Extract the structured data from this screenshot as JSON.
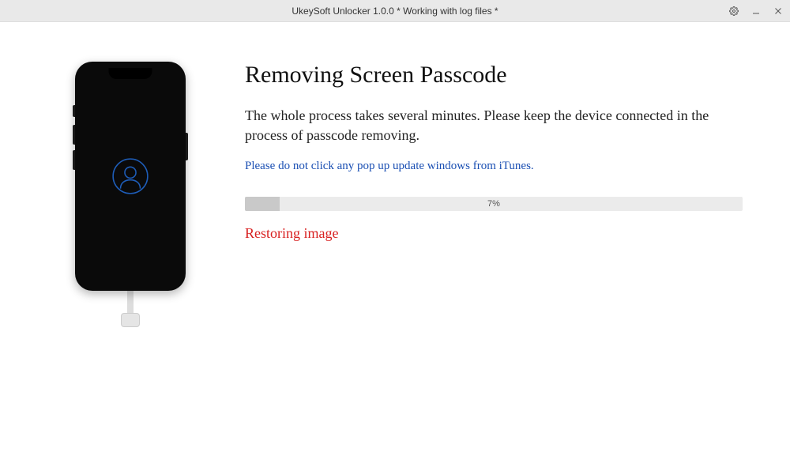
{
  "titlebar": {
    "title": "UkeySoft Unlocker 1.0.0 * Working with log files *"
  },
  "main": {
    "heading": "Removing Screen Passcode",
    "description": "The whole process takes several minutes. Please keep the device connected in the process of passcode removing.",
    "warning": "Please do not click any pop up update windows from iTunes.",
    "progress_percent": 7,
    "progress_label": "7%",
    "status": "Restoring image"
  }
}
